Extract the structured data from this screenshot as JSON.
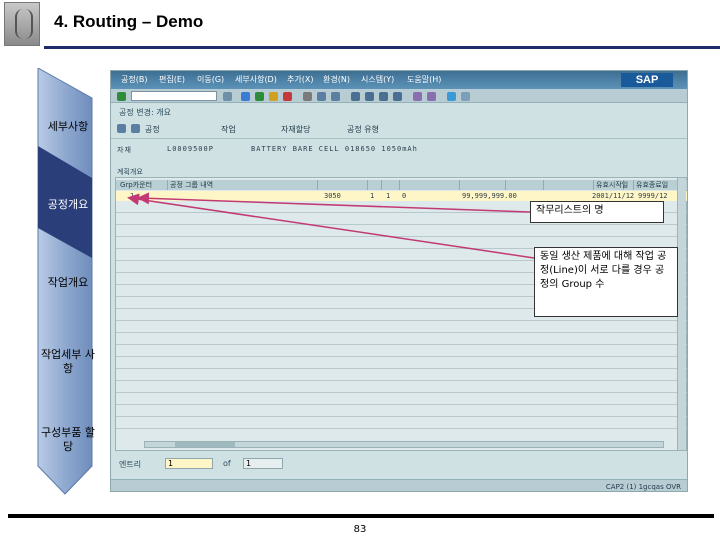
{
  "slide": {
    "title": "4. Routing – Demo",
    "page_number": "83"
  },
  "process_steps": [
    {
      "label": "세부사항"
    },
    {
      "label": "공정개요"
    },
    {
      "label": "작업개요"
    },
    {
      "label": "작업세부 사항"
    },
    {
      "label": "구성부품 할당"
    }
  ],
  "sap": {
    "menu": [
      "공정(B)",
      "편집(E)",
      "이동(G)",
      "세부사항(D)",
      "추가(X)",
      "환경(N)",
      "시스템(Y)",
      "도움말(H)"
    ],
    "logo": "SAP",
    "screen_title": "공정 변경: 개요",
    "toolbar2": [
      "공정",
      "작업",
      "자재할당",
      "공정 유형"
    ],
    "plant_label": "자재",
    "plant_code": "L0009500P",
    "plant_desc": "BATTERY BARE CELL 018650 1050mAh",
    "grid_caption": "계획개요",
    "grid_headers": [
      "Grp카운터",
      "공정 그룹 내역",
      "",
      "",
      "",
      "",
      "",
      "",
      "",
      "유효시작일",
      "",
      "유효종료일"
    ],
    "row1": {
      "col1": "1",
      "col2": "",
      "col3": "3050",
      "col4": "1",
      "col5": "1",
      "col6": "0",
      "col7": "99,999,999.00",
      "col8": "2001/11/12",
      "col9": "9999/12"
    },
    "entry_label": "엔트리",
    "entry_value": "1",
    "entry_of": "of",
    "entry_total": "1",
    "status": "CAP2 (1) 1gcqas OVR"
  },
  "callouts": {
    "c1": "작무리스트의 명",
    "c2": "동일 생산 제품에 대해 작업 공정(Line)이 서로 다를 경우 공정의 Group 수"
  },
  "colors": {
    "title_rule": "#1d2b6d",
    "arrow_fill": "#8fa9cf",
    "arrow_dark": "#2a3f7a",
    "callout_line": "#c23a74"
  }
}
